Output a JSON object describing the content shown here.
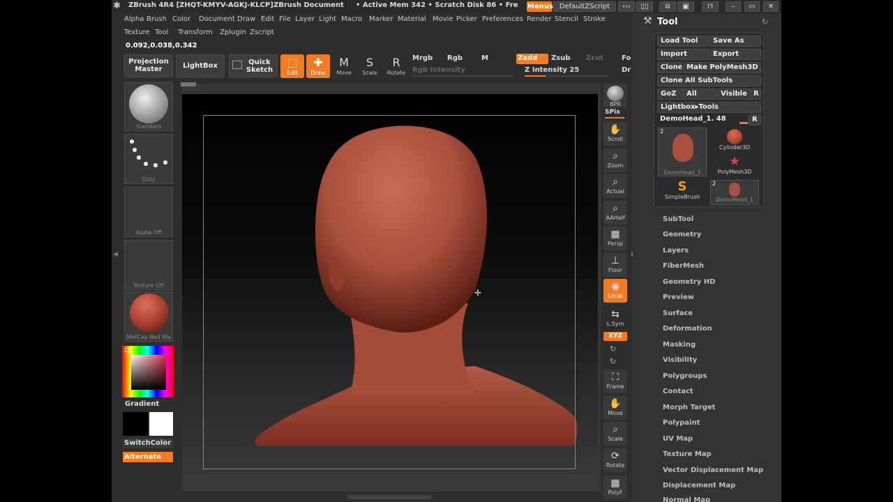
{
  "titlebar": {
    "app": "ZBrush 4R4 [ZHQT-KMYV-AGKJ-KLCP]",
    "document": "ZBrush Document",
    "status": "• Active Mem 342 • Scratch Disk 86 • Fre",
    "menus_btn": "Menus",
    "script_btn": "DefaultZScript"
  },
  "menubar": [
    "Alpha",
    "Brush",
    "Color",
    "Document",
    "Draw",
    "Edit",
    "File",
    "Layer",
    "Light",
    "Macro",
    "Marker",
    "Material",
    "Movie",
    "Picker",
    "Preferences",
    "Render",
    "Stencil",
    "Stroke"
  ],
  "menubar2": [
    "Texture",
    "Tool",
    "Transform",
    "Zplugin",
    "Zscript"
  ],
  "coordinates": "0.092,0.038,0.342",
  "shelf": {
    "projection_master": "Projection Master",
    "lightbox": "LightBox",
    "quick_sketch": "Quick Sketch",
    "edit": "Edit",
    "draw": "Draw",
    "move": "Move",
    "scale": "Scale",
    "rotate": "Rotate",
    "mrgb": "Mrgb",
    "rgb": "Rgb",
    "m": "M",
    "rgb_intensity": "Rgb Intensity",
    "zadd": "Zadd",
    "zsub": "Zsub",
    "zcut": "Zcut",
    "z_intensity": "Z Intensity 25",
    "z_intensity_value": 25,
    "focal": "Fo",
    "draw_size": "Dr"
  },
  "left_shelf": {
    "brush": "Standard",
    "stroke": "Dots",
    "alpha": "Alpha Off",
    "texture": "Texture Off",
    "material": "MatCap Red Wa",
    "gradient": "Gradient",
    "switch_color": "SwitchColor",
    "alternate": "Alternate"
  },
  "right_shelf": [
    {
      "name": "bpr",
      "label": "BPR",
      "icon": "bpr-icon"
    },
    {
      "name": "spix",
      "label": "SPix",
      "icon": "spix-icon"
    },
    {
      "name": "scroll",
      "label": "Scroll",
      "icon": "hand-icon"
    },
    {
      "name": "zoom",
      "label": "Zoom",
      "icon": "zoom-icon"
    },
    {
      "name": "actual",
      "label": "Actual",
      "icon": "actual-icon"
    },
    {
      "name": "aahalf",
      "label": "AAHalf",
      "icon": "aahalf-icon"
    },
    {
      "name": "persp",
      "label": "Persp",
      "icon": "persp-icon"
    },
    {
      "name": "floor",
      "label": "Floor",
      "icon": "floor-icon"
    },
    {
      "name": "local",
      "label": "Local",
      "icon": "local-icon"
    },
    {
      "name": "lsym",
      "label": "L.Sym",
      "icon": "lsym-icon"
    },
    {
      "name": "xyz",
      "label": "XYZ",
      "icon": "xyz-icon"
    },
    {
      "name": "frame",
      "label": "Frame",
      "icon": "frame-icon"
    },
    {
      "name": "move",
      "label": "Move",
      "icon": "move-icon"
    },
    {
      "name": "scale",
      "label": "Scale",
      "icon": "scale-icon"
    },
    {
      "name": "rotate",
      "label": "Rotate",
      "icon": "rotate-icon"
    },
    {
      "name": "polyf",
      "label": "PolyF",
      "icon": "polyf-icon"
    }
  ],
  "tool_palette": {
    "title": "Tool",
    "load_tool": "Load Tool",
    "save_as": "Save As",
    "import": "Import",
    "export": "Export",
    "clone": "Clone",
    "make_polymesh": "Make PolyMesh3D",
    "clone_all": "Clone All SubTools",
    "goz": "GoZ",
    "all": "All",
    "visible": "Visible",
    "r": "R",
    "lightbox_tools": "Lightbox▸Tools",
    "current_tool": "DemoHead_1. 48",
    "tools": [
      {
        "name": "DemoHead_1",
        "count": "2"
      },
      {
        "name": "Cylinder3D",
        "count": ""
      },
      {
        "name": "PolyMesh3D",
        "count": ""
      },
      {
        "name": "SimpleBrush",
        "count": ""
      },
      {
        "name": "DemoHead_1",
        "count": "2"
      }
    ],
    "subpalettes": [
      "SubTool",
      "Geometry",
      "Layers",
      "FiberMesh",
      "Geometry HD",
      "Preview",
      "Surface",
      "Deformation",
      "Masking",
      "Visibility",
      "Polygroups",
      "Contact",
      "Morph Target",
      "Polypaint",
      "UV Map",
      "Texture Map",
      "Vector Displacement Map",
      "Displacement Map",
      "Normal Map"
    ]
  },
  "colors": {
    "accent": "#f47b20",
    "model": "#b0503c",
    "background": "#2e2e2e"
  }
}
